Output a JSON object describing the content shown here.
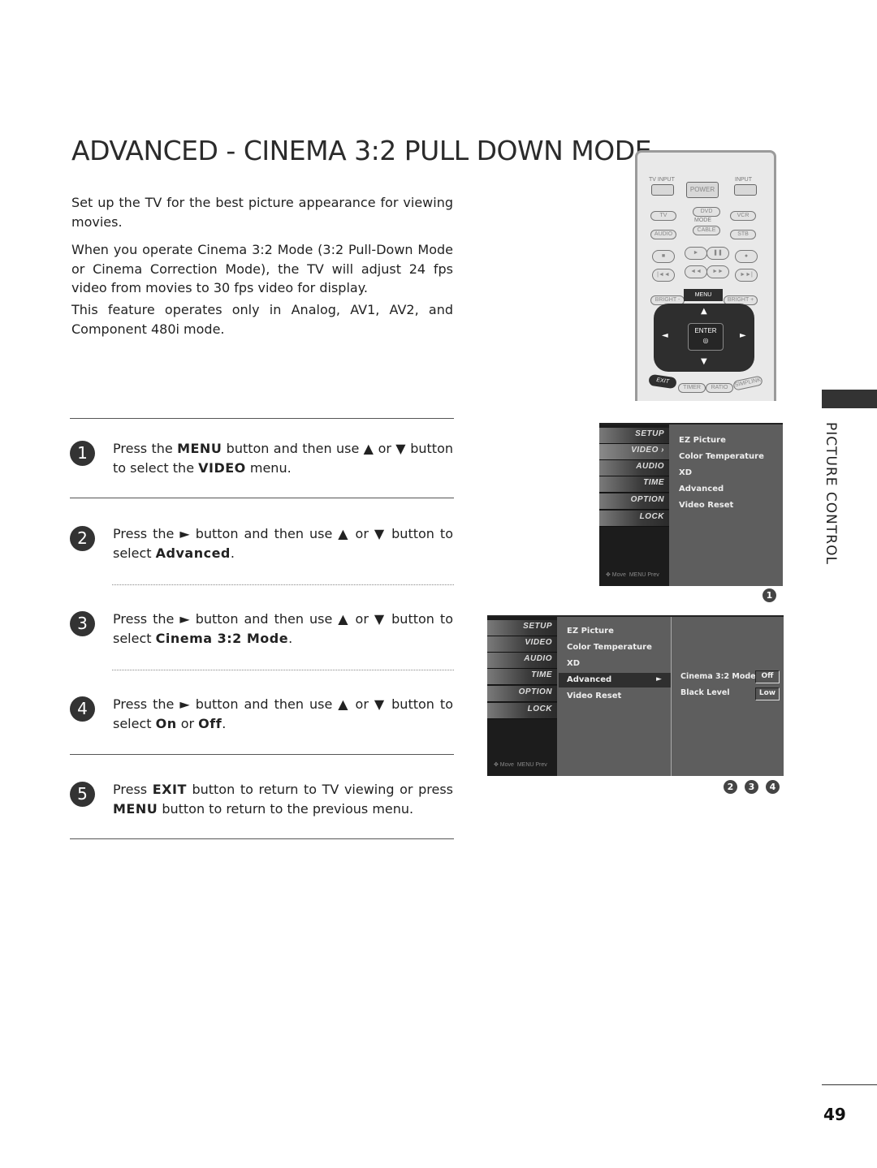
{
  "title": "ADVANCED - CINEMA 3:2 PULL DOWN MODE",
  "intro": [
    "Set up the TV for the best picture appearance for viewing movies.",
    "When you operate Cinema 3:2 Mode (3:2 Pull-Down Mode or Cinema Correction Mode), the TV will adjust 24 fps video from movies to 30 fps video for display.",
    "This feature operates only in Analog, AV1, AV2, and Component 480i mode."
  ],
  "steps": [
    {
      "num": "1",
      "pre": "Press the ",
      "b1": "MENU",
      "mid": " button and then use ▲ or ▼ button to select the ",
      "b2": "VIDEO",
      "post": " menu."
    },
    {
      "num": "2",
      "pre": "Press the ► button and then use ▲ or ▼ button to select ",
      "b1": "Advanced",
      "post": "."
    },
    {
      "num": "3",
      "pre": "Press the ► button and then use ▲ or ▼ button to select ",
      "b1": "Cinema 3:2 Mode",
      "post": "."
    },
    {
      "num": "4",
      "pre": "Press the ► button and then use ▲ or ▼ button to select ",
      "b1": "On",
      "mid": " or ",
      "b2": "Off",
      "post": "."
    },
    {
      "num": "5",
      "pre": "Press ",
      "b1": "EXIT",
      "mid": " button to return to TV viewing or press ",
      "b2": "MENU",
      "post": " button to return to the previous menu."
    }
  ],
  "remote": {
    "tv_input": "TV INPUT",
    "input": "INPUT",
    "power": "POWER",
    "tv": "TV",
    "dvd": "DVD",
    "vcr": "VCR",
    "mode": "MODE",
    "audio": "AUDIO",
    "cable": "CABLE",
    "stb": "STB",
    "stop": "■",
    "play": "►",
    "pause": "❚❚",
    "rec": "●",
    "skip_back": "|◄◄",
    "rew": "◄◄",
    "ff": "►►",
    "skip_fwd": "►►|",
    "bright_minus": "BRIGHT -",
    "menu": "MENU",
    "bright_plus": "BRIGHT +",
    "enter": "ENTER",
    "enter_symbol": "◎",
    "up": "▲",
    "down": "▼",
    "left": "◄",
    "right": "►",
    "exit": "EXIT",
    "timer": "TIMER",
    "ratio": "RATIO",
    "simplink": "SIMPLINK"
  },
  "osd_tabs": [
    "SETUP",
    "VIDEO",
    "AUDIO",
    "TIME",
    "OPTION",
    "LOCK"
  ],
  "osd_footer": {
    "move": "✥ Move",
    "prev": "MENU Prev"
  },
  "osd1": {
    "active_tab_suffix": "VIDEO ›",
    "items": [
      "EZ Picture",
      "Color Temperature",
      "XD",
      "Advanced",
      "Video Reset"
    ],
    "badge": "1"
  },
  "osd2": {
    "items": [
      "EZ Picture",
      "Color Temperature",
      "XD",
      "Advanced",
      "Video Reset"
    ],
    "selected_arrow": "►",
    "sub_items": [
      {
        "label": "Cinema 3:2 Mode",
        "value": "Off"
      },
      {
        "label": "Black Level",
        "value": "Low"
      }
    ],
    "badges": [
      "2",
      "3",
      "4"
    ]
  },
  "side_label": "PICTURE CONTROL",
  "page_number": "49"
}
